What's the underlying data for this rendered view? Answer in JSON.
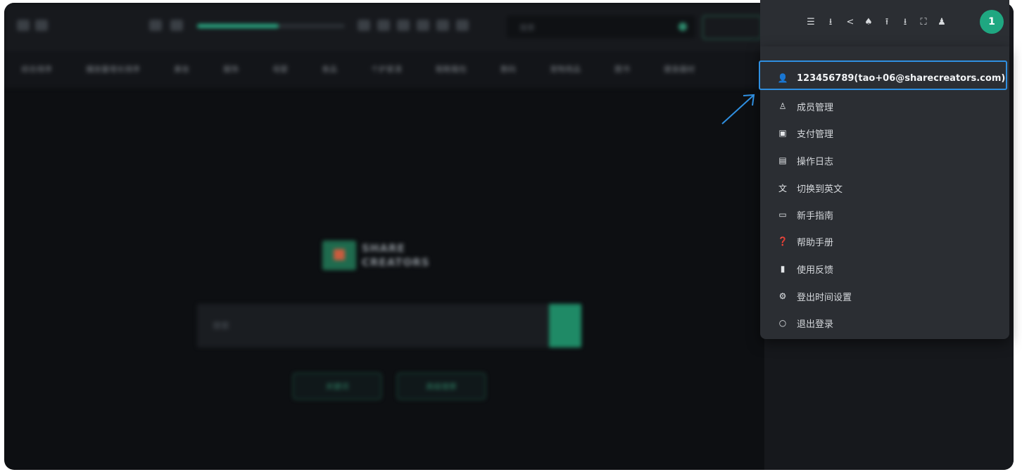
{
  "topbar": {
    "search_placeholder": "搜索"
  },
  "tabs": [
    "综合排序",
    "播放量增长排序",
    "美妆",
    "服饰",
    "母婴",
    "食品",
    "个护家清",
    "鞋靴箱包",
    "数码",
    "宠物用品",
    "图书",
    "健身器材"
  ],
  "center": {
    "logo_line1": "SHARE",
    "logo_line2": "CREATORS",
    "search_placeholder": "搜索",
    "buttons": [
      "关键词",
      "高级搜索"
    ]
  },
  "header_icons": [
    "list-icon",
    "download-icon",
    "share-icon",
    "bell-icon",
    "upload-icon",
    "export-icon",
    "fullscreen-icon",
    "user-switch-icon"
  ],
  "avatar_text": "1",
  "menu": {
    "account": "123456789(tao+06@sharecreators.com)",
    "items": [
      {
        "label": "成员管理",
        "icon": "members-icon"
      },
      {
        "label": "支付管理",
        "icon": "wallet-icon"
      },
      {
        "label": "操作日志",
        "icon": "log-icon"
      },
      {
        "label": "切换到英文",
        "icon": "translate-icon"
      },
      {
        "label": "新手指南",
        "icon": "guide-icon"
      },
      {
        "label": "帮助手册",
        "icon": "help-icon"
      },
      {
        "label": "使用反馈",
        "icon": "feedback-icon"
      },
      {
        "label": "登出时间设置",
        "icon": "clock-settings-icon"
      },
      {
        "label": "退出登录",
        "icon": "logout-icon"
      }
    ]
  },
  "colors": {
    "accent": "#1fa781",
    "highlight": "#2f8fe0",
    "menu_bg": "#2b2e33"
  }
}
